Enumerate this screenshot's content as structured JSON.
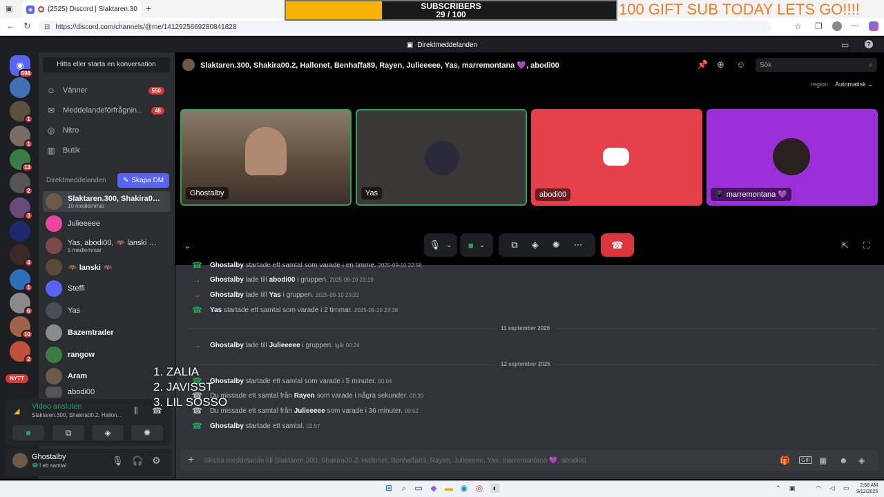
{
  "browser": {
    "tab_title": "(2525) Discord | Slaktaren.30",
    "url": "https://discord.com/channels/@me/1412925669280841828"
  },
  "overlay": {
    "subs_label": "SUBSCRIBERS",
    "subs_count": "29 / 100",
    "subs_progress": 0.29,
    "gift_text": "100 GIFT SUB TODAY LETS GO!!!!",
    "list": [
      "1. ZALIA",
      "2. JAVISST",
      "3. LIL SOSSO"
    ]
  },
  "app": {
    "title": "Direktmeddelanden"
  },
  "rail": {
    "home_badge": "598",
    "badges": [
      "1",
      "1",
      "13",
      "2",
      "3",
      "4",
      "1",
      "6",
      "10",
      "2"
    ],
    "new_label": "NYTT"
  },
  "sidebar": {
    "find_conv": "Hitta eller starta en konversation",
    "nav": [
      {
        "label": "Vänner",
        "badge": "550",
        "icon": "people-icon"
      },
      {
        "label": "Meddelandeförfrågnin...",
        "badge": "48",
        "icon": "envelope-icon"
      },
      {
        "label": "Nitro",
        "badge": "",
        "icon": "nitro-icon"
      },
      {
        "label": "Butik",
        "badge": "",
        "icon": "shop-icon"
      }
    ],
    "dm_header": "Direktmeddelanden",
    "create_dm": "Skapa DM",
    "dms": [
      {
        "name": "Slaktaren.300, Shakira00....",
        "sub": "10 medlemmar"
      },
      {
        "name": "Julieeeee",
        "sub": ""
      },
      {
        "name": "Yas, abodi00, 🦇 lanski 🦇...",
        "sub": "5 medlemmar"
      },
      {
        "name": "🦇 lanski 🦇",
        "sub": ""
      },
      {
        "name": "Steffi",
        "sub": ""
      },
      {
        "name": "Yas",
        "sub": ""
      },
      {
        "name": "Bazemtrader",
        "sub": ""
      },
      {
        "name": "rangow",
        "sub": ""
      },
      {
        "name": "Aram",
        "sub": ""
      },
      {
        "name": "abodi00",
        "sub": ""
      }
    ]
  },
  "voice": {
    "status": "Video ansluten",
    "channel": "Slaktaren.300, Shakira00.2, Hallon..."
  },
  "user": {
    "name": "Ghostalby",
    "status": "I ett samtal"
  },
  "header": {
    "group_title": "Slaktaren.300, Shakira00.2, Hallonet, Benhaffa89, Rayen, Julieeeee, Yas, marremontana 💜, abodi00",
    "search_placeholder": "Sök",
    "region_label": "region",
    "region_value": "Automatisk"
  },
  "tiles": [
    {
      "name": "Ghostalby",
      "color": "#6b5a4a"
    },
    {
      "name": "Yas",
      "color": "#3a3836"
    },
    {
      "name": "abodi00",
      "color": "#e5404a"
    },
    {
      "name": "📱 marremontana 💜",
      "color": "#9b30d9"
    }
  ],
  "chat": {
    "messages": [
      {
        "user": "Ghostalby",
        "text": "startade ett samtal som varade i en timme.",
        "target": "",
        "suffix": "",
        "time": "2025-09-10 22:58",
        "kind": "call"
      },
      {
        "user": "Ghostalby",
        "text": "lade till",
        "target": "abodi00",
        "suffix": "i gruppen.",
        "time": "2025-09-10 23:19",
        "kind": "add"
      },
      {
        "user": "Ghostalby",
        "text": "lade till",
        "target": "Yas",
        "suffix": "i gruppen.",
        "time": "2025-09-10 23:22",
        "kind": "add"
      },
      {
        "user": "Yas",
        "text": "startade ett samtal som varade i 2 timmar.",
        "target": "",
        "suffix": "",
        "time": "2025-09-10 23:38",
        "kind": "call"
      },
      {
        "user": "Ghostalby",
        "text": "lade till",
        "target": "Julieeeee",
        "suffix": "i gruppen.",
        "time": "Igår 00:24",
        "kind": "add"
      },
      {
        "user": "Ghostalby",
        "text": "startade ett samtal som varade i 5 minuter.",
        "target": "",
        "suffix": "",
        "time": "00:04",
        "kind": "call"
      },
      {
        "user": "",
        "text": "Du missade ett samtal från",
        "target": "Rayen",
        "suffix": "som varade i några sekunder.",
        "time": "00:30",
        "kind": "missed"
      },
      {
        "user": "",
        "text": "Du missade ett samtal från",
        "target": "Julieeeee",
        "suffix": "som varade i 36 minuter.",
        "time": "00:52",
        "kind": "missed"
      },
      {
        "user": "Ghostalby",
        "text": "startade ett samtal.",
        "target": "",
        "suffix": "",
        "time": "02:57",
        "kind": "call"
      }
    ],
    "dividers": [
      "11 september 2025",
      "12 september 2025"
    ],
    "composer_placeholder": "Skicka meddelande till Slaktaren.300, Shakira00.2, Hallonet, Benhaffa89, Rayen, Julieeeee, Yas, marremontana 💜, abodi00"
  },
  "taskbar": {
    "time": "2:58 AM",
    "date": "9/12/2025"
  },
  "colors": {
    "blurple": "#5865f2",
    "danger": "#da373c",
    "online": "#23a55a",
    "gold": "#f5b400"
  }
}
